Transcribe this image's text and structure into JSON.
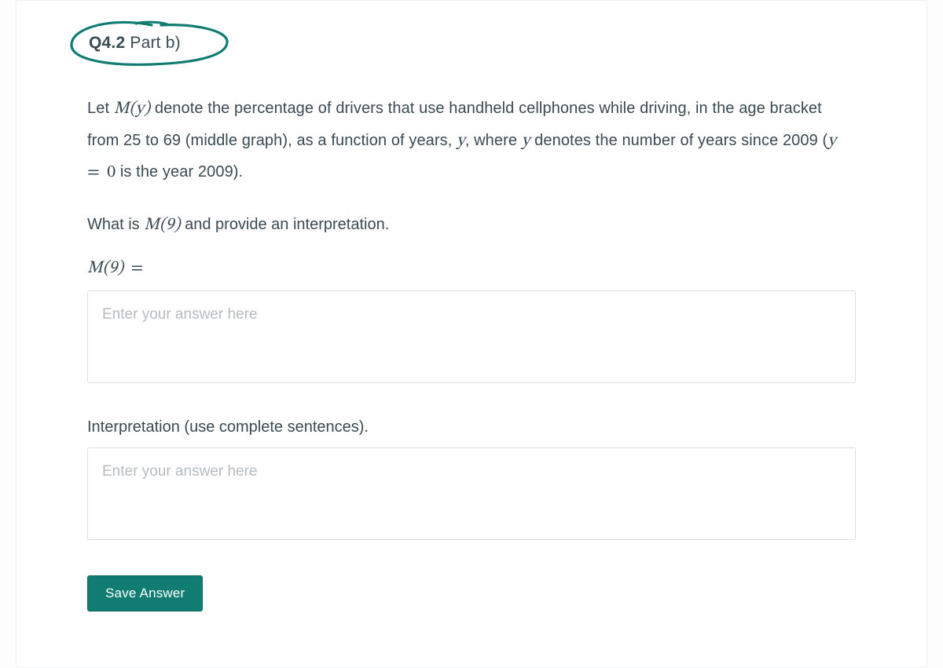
{
  "heading": {
    "qnum": "Q4.2",
    "part": "Part b)"
  },
  "para1": {
    "pre": "Let ",
    "m_My": "M(y)",
    "mid1": " denote the percentage of drivers that use handheld cellphones while driving, in the age bracket from 25 to 69 (middle graph), as a function of years, ",
    "y1": "y",
    "mid2": ", where ",
    "y2": "y",
    "mid3": " denotes the number of years since 2009 (",
    "y3": "y",
    "eq": " = ",
    "zero": "0",
    "post": " is the year 2009)."
  },
  "prompt2": {
    "pre": "What is ",
    "m_M9": "M(9)",
    "post": " and provide an interpretation."
  },
  "eq_line": {
    "lhs": "M(9)",
    "eq": " = "
  },
  "answer1": {
    "placeholder": "Enter your answer here"
  },
  "label2": "Interpretation (use complete sentences).",
  "answer2": {
    "placeholder": "Enter your answer here"
  },
  "save_label": "Save Answer"
}
